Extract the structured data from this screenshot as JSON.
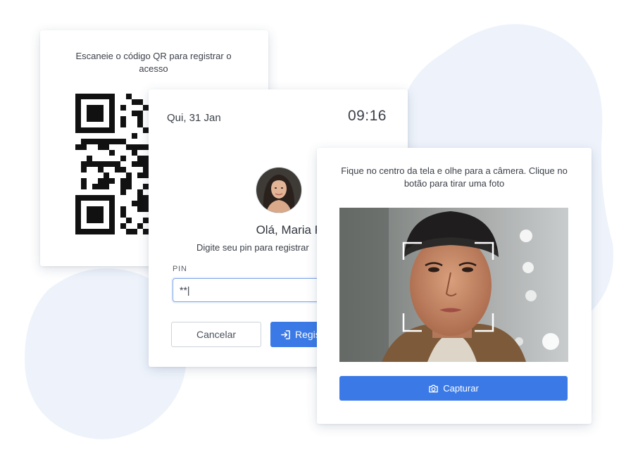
{
  "qr_card": {
    "instruction": "Escaneie o código QR para registrar o acesso"
  },
  "pin_card": {
    "date": "Qui, 31 Jan",
    "time": "09:16",
    "greeting": "Olá, Maria Rosa",
    "instruction": "Digite seu pin para registrar",
    "pin_label": "PIN",
    "pin_value": "**|",
    "cancel_label": "Cancelar",
    "register_label": "Registrar",
    "icons": {
      "avatar": "user-avatar-photo",
      "register": "sign-in-icon"
    }
  },
  "camera_card": {
    "instruction": "Fique no centro da tela e olhe para a câmera. Clique no botão para tirar uma foto",
    "capture_label": "Capturar",
    "icons": {
      "capture": "camera-icon",
      "frame": "face-frame-icon"
    }
  },
  "colors": {
    "accent": "#3b7ae6",
    "background_blob": "#eef3fb",
    "input_border": "#7fa6e8"
  }
}
